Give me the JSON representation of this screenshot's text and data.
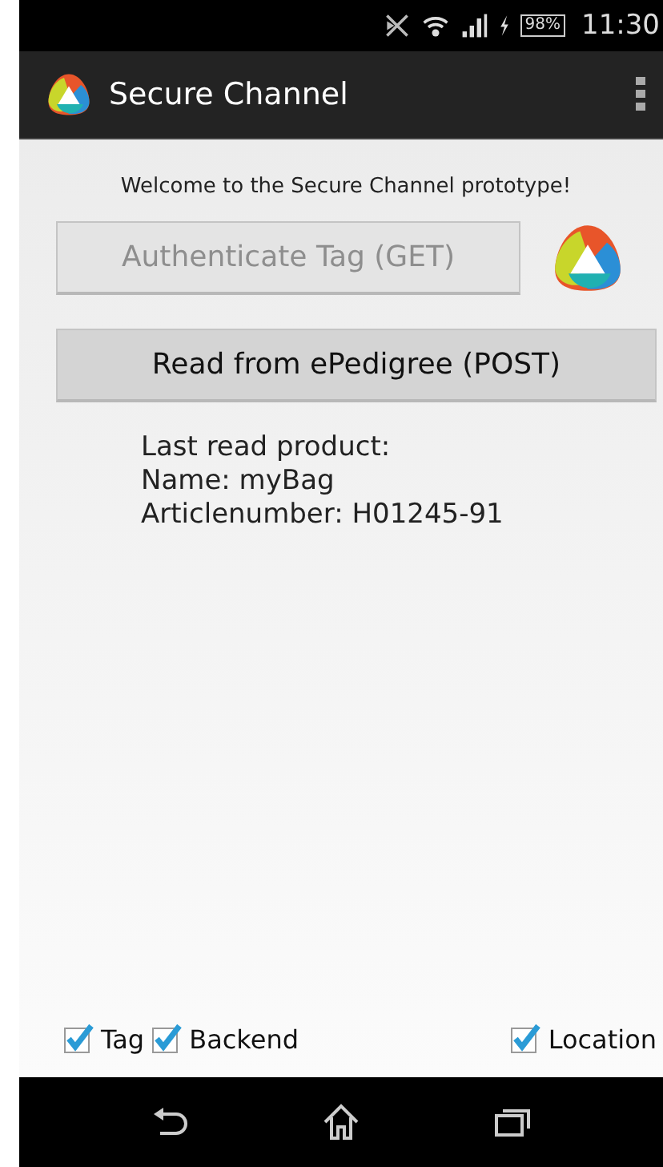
{
  "status_bar": {
    "battery": "98%",
    "time": "11:30"
  },
  "app_bar": {
    "title": "Secure Channel"
  },
  "welcome": "Welcome to the Secure Channel prototype!",
  "buttons": [
    {
      "label": "Authenticate Tag (GET)",
      "disabled": true
    },
    {
      "label": "Read from ePedigree (POST)",
      "disabled": false
    }
  ],
  "product_info": [
    "Last read product:",
    "Name: myBag",
    "Articlenumber: H01245-91"
  ],
  "checkboxes": [
    {
      "label": "Tag",
      "checked": true
    },
    {
      "label": "Backend",
      "checked": true
    },
    {
      "label": "Location",
      "checked": true
    }
  ]
}
